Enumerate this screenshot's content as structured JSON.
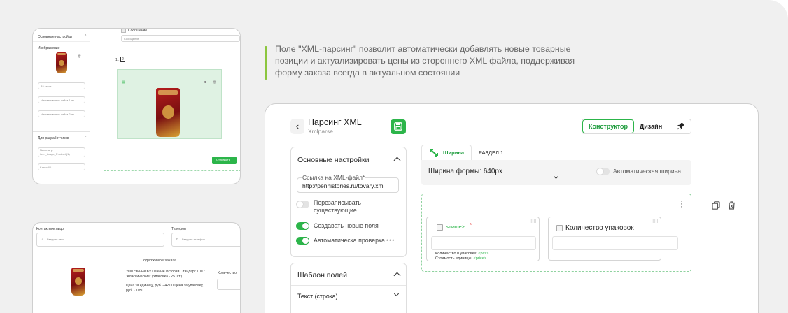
{
  "info_text": "Поле \"XML-парсинг\" позволит автоматически добавлять новые товарные позиции и актуализировать цены из стороннего XML файла, поддерживая форму заказа всегда в актуальном состоянии",
  "colors": {
    "accent": "#2cb54a",
    "info_bar": "#8cc63f",
    "dashed": "#8fd29f"
  },
  "thumb1": {
    "section_main": "Основные настройки",
    "image_label": "Изображение",
    "inputs": [
      "Alt текст",
      "Наименование сайта 1 из",
      "Наименование сайта 2 из"
    ],
    "section_dev": "Для разработчиков",
    "dev_text_1": "Name атр.",
    "dev_text_2": "item_image_Product (1)",
    "dev_text_3": "Класс-ID",
    "message_label": "Сообщение",
    "message_placeholder": "Сообщение",
    "pager_label": "1 :",
    "pager_value": "2",
    "submit": "Отправить"
  },
  "thumb2": {
    "contact_label": "Контактное лицо",
    "contact_placeholder": "Введите имя",
    "phone_label": "Телефон",
    "phone_placeholder": "Введите телефон",
    "order_title": "Содержимое заказа",
    "item_desc": "Уши свиные в/к Пенные Истории Стандарт 100 г \"Классические\" (Упаковка - 25 шт.)",
    "price_line": "Цена за единицу, руб. - 42.00 Цена за упаковку, руб. - 1050",
    "qty_label": "Количество"
  },
  "header": {
    "back_icon": "chevron-left-icon",
    "title": "Парсинг XML",
    "subtitle": "Xmlparse",
    "save_icon": "save-icon",
    "mode_constructor": "Конструктор",
    "mode_design": "Дизайн",
    "rocket_icon": "rocket-icon"
  },
  "settings": {
    "title": "Основные настройки",
    "url_label": "Ссылка на XML-файл*",
    "url_value": "http://penhistories.ru/tovary.xml",
    "overwrite": "Перезаписывать существующие",
    "create_new": "Создавать новые поля",
    "auto_check": "Автоматическа проверка",
    "dots": "•••"
  },
  "template": {
    "title": "Шаблон полей",
    "selected": "Текст (строка)"
  },
  "tabs": {
    "width_tab": "Ширина",
    "section_tab": "РАЗДЕЛ 1",
    "form_width": "Ширина формы: 640px",
    "auto_width": "Автоматическая ширина"
  },
  "fields": {
    "name_label": "<name>",
    "required_mark": "*",
    "qty_pack_label": "Количество упаковок",
    "pack_count_label": "Количество в упаковке:",
    "pack_count_val": "<pcs>",
    "unit_price_label": "Стоимость единицы:",
    "unit_price_val": "<price>"
  }
}
